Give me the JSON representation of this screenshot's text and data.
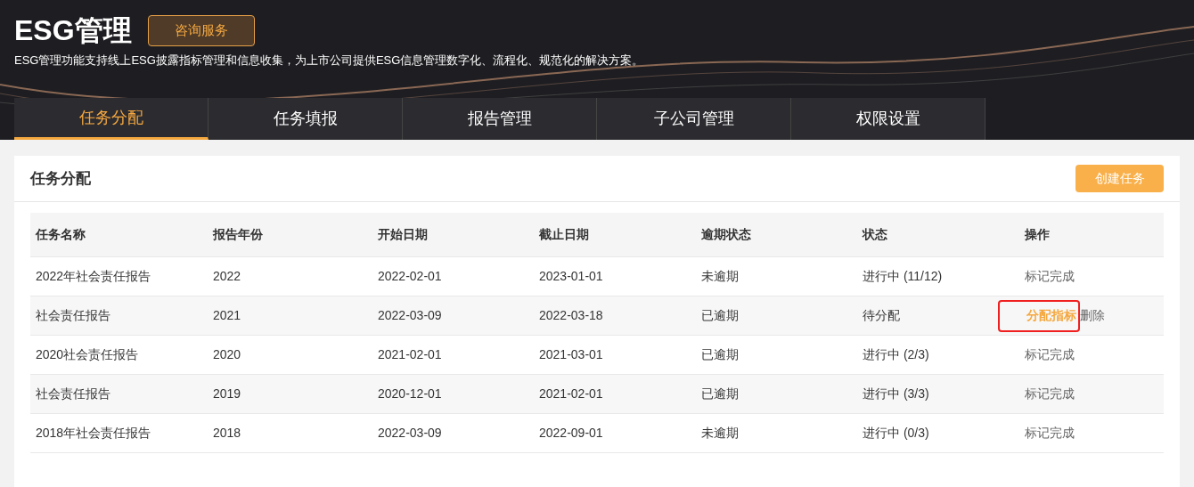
{
  "header": {
    "title": "ESG管理",
    "consult_button": "咨询服务",
    "description": "ESG管理功能支持线上ESG披露指标管理和信息收集，为上市公司提供ESG信息管理数字化、流程化、规范化的解决方案。"
  },
  "tabs": [
    {
      "label": "任务分配",
      "selected": true
    },
    {
      "label": "任务填报",
      "selected": false
    },
    {
      "label": "报告管理",
      "selected": false
    },
    {
      "label": "子公司管理",
      "selected": false
    },
    {
      "label": "权限设置",
      "selected": false
    }
  ],
  "panel": {
    "title": "任务分配",
    "create_button": "创建任务"
  },
  "table": {
    "columns": [
      "任务名称",
      "报告年份",
      "开始日期",
      "截止日期",
      "逾期状态",
      "状态",
      "操作"
    ],
    "rows": [
      {
        "cells": [
          "2022年社会责任报告",
          "2022",
          "2022-02-01",
          "2023-01-01",
          "未逾期",
          "进行中 (11/12)"
        ],
        "actions": [
          {
            "label": "标记完成",
            "highlighted": false
          }
        ]
      },
      {
        "cells": [
          "社会责任报告",
          "2021",
          "2022-03-09",
          "2022-03-18",
          "已逾期",
          "待分配"
        ],
        "actions": [
          {
            "label": "分配指标",
            "highlighted": true
          },
          {
            "label": "删除",
            "highlighted": false
          }
        ]
      },
      {
        "cells": [
          "2020社会责任报告",
          "2020",
          "2021-02-01",
          "2021-03-01",
          "已逾期",
          "进行中 (2/3)"
        ],
        "actions": [
          {
            "label": "标记完成",
            "highlighted": false
          }
        ]
      },
      {
        "cells": [
          "社会责任报告",
          "2019",
          "2020-12-01",
          "2021-02-01",
          "已逾期",
          "进行中 (3/3)"
        ],
        "actions": [
          {
            "label": "标记完成",
            "highlighted": false
          }
        ]
      },
      {
        "cells": [
          "2018年社会责任报告",
          "2018",
          "2022-03-09",
          "2022-09-01",
          "未逾期",
          "进行中 (0/3)"
        ],
        "actions": [
          {
            "label": "标记完成",
            "highlighted": false
          }
        ]
      }
    ]
  }
}
